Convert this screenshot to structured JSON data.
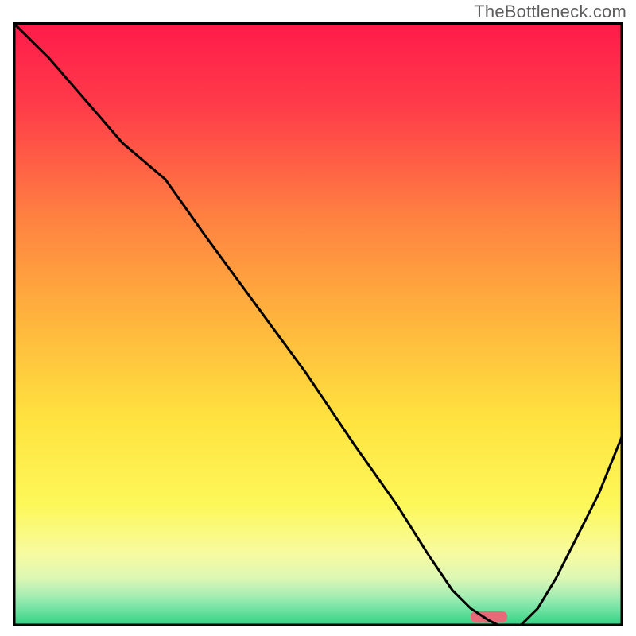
{
  "watermark": "TheBottleneck.com",
  "chart_data": {
    "type": "line",
    "title": "",
    "xlabel": "",
    "ylabel": "",
    "xlim": [
      0,
      100
    ],
    "ylim": [
      0,
      100
    ],
    "grid": false,
    "background": {
      "type": "vertical_gradient",
      "stops": [
        {
          "pos": 0,
          "color": "#ff1a4a"
        },
        {
          "pos": 14,
          "color": "#ff3c49"
        },
        {
          "pos": 32,
          "color": "#ff8041"
        },
        {
          "pos": 50,
          "color": "#ffb73d"
        },
        {
          "pos": 66,
          "color": "#ffe33f"
        },
        {
          "pos": 80,
          "color": "#fdf85a"
        },
        {
          "pos": 88,
          "color": "#f7fba0"
        },
        {
          "pos": 92,
          "color": "#dcf7b4"
        },
        {
          "pos": 95,
          "color": "#a4edb3"
        },
        {
          "pos": 97,
          "color": "#74e3a4"
        },
        {
          "pos": 100,
          "color": "#2ad07f"
        }
      ]
    },
    "series": [
      {
        "name": "bottleneck_curve",
        "type": "line",
        "x": [
          0,
          6,
          12,
          18,
          25,
          32,
          40,
          48,
          56,
          63,
          68,
          72,
          75,
          78,
          80,
          83,
          86,
          89,
          92,
          96,
          100
        ],
        "y": [
          100,
          94,
          87,
          80,
          74,
          64,
          53,
          42,
          30,
          20,
          12,
          6,
          3,
          1,
          0,
          0,
          3,
          8,
          14,
          22,
          32
        ]
      }
    ],
    "marker": {
      "name": "optimal_marker",
      "x_center": 78,
      "y": 1.6,
      "width": 6,
      "height": 1.8,
      "color": "#e86a78"
    },
    "frame_color": "#000000"
  }
}
